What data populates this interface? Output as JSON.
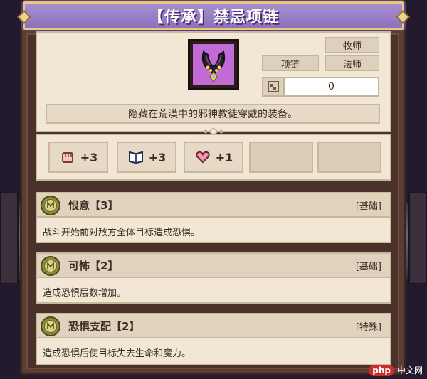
{
  "title": "【传承】禁忌项链",
  "item": {
    "icon": "cursed-necklace-icon",
    "tags": {
      "priest": "牧师",
      "necklace": "项链",
      "mage": "法师"
    },
    "value_icon": "slot-icon",
    "value": "0",
    "description": "隐藏在荒漠中的邪神教徒穿戴的装备。"
  },
  "stats": [
    {
      "icon": "fist-icon",
      "value": "+3"
    },
    {
      "icon": "book-icon",
      "value": "+3"
    },
    {
      "icon": "heart-icon",
      "value": "+1"
    }
  ],
  "skills": [
    {
      "icon": "skill-rune-icon",
      "name": "恨意【3】",
      "type": "[基础]",
      "desc": "战斗开始前对敌方全体目标造成恐惧。"
    },
    {
      "icon": "skill-rune-icon",
      "name": "可怖【2】",
      "type": "[基础]",
      "desc": "造成恐惧层数增加。"
    },
    {
      "icon": "skill-rune-icon",
      "name": "恐惧支配【2】",
      "type": "[特殊]",
      "desc": "造成恐惧后使目标失去生命和魔力。"
    }
  ],
  "watermark": {
    "logo": "php",
    "text": "中文网"
  },
  "colors": {
    "title_banner": "#9b80c8",
    "title_border": "#e8c97a",
    "card_bg": "#f2e7d5",
    "frame_brown": "#5b3d32",
    "item_bg": "#c06bd6"
  }
}
